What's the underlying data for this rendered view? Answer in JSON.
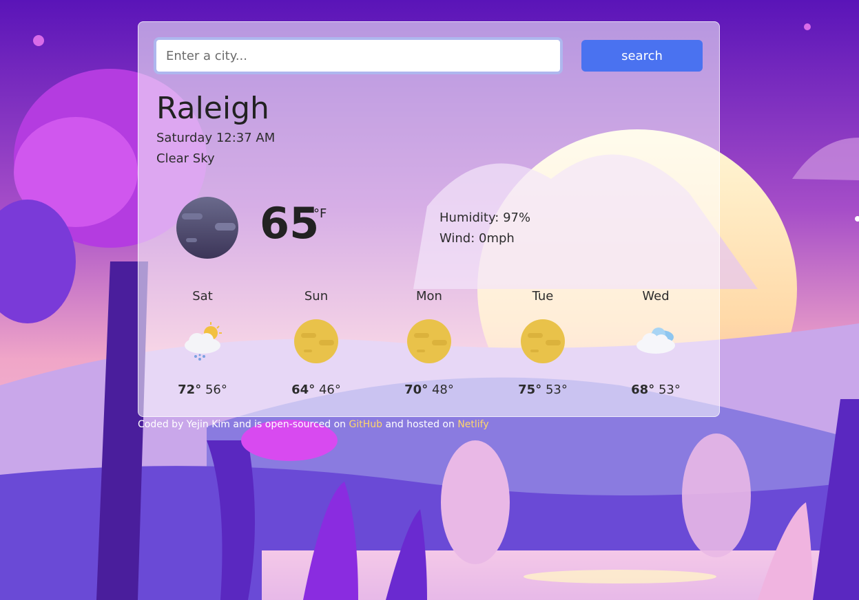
{
  "search": {
    "placeholder": "Enter a city...",
    "button_label": "search"
  },
  "current": {
    "city": "Raleigh",
    "datetime": "Saturday 12:37 AM",
    "condition": "Clear Sky",
    "icon": "moon-icon",
    "temperature": "65",
    "unit": "°F",
    "humidity": "Humidity: 97%",
    "wind": "Wind: 0mph"
  },
  "forecast": [
    {
      "day": "Sat",
      "high": "72°",
      "low": "56°",
      "icon": "partly-cloudy-rain-icon"
    },
    {
      "day": "Sun",
      "high": "64°",
      "low": "46°",
      "icon": "sun-icon"
    },
    {
      "day": "Mon",
      "high": "70°",
      "low": "48°",
      "icon": "sun-icon"
    },
    {
      "day": "Tue",
      "high": "75°",
      "low": "53°",
      "icon": "sun-icon"
    },
    {
      "day": "Wed",
      "high": "68°",
      "low": "53°",
      "icon": "cloud-icon"
    }
  ],
  "footer": {
    "text_1": "Coded by Yejin Kim and is open-sourced on",
    "github_label": "GitHub",
    "text_2": "and hosted on",
    "netlify_label": "Netlify"
  },
  "colors": {
    "accent": "#4a72f0",
    "link": "#ffd76a"
  }
}
